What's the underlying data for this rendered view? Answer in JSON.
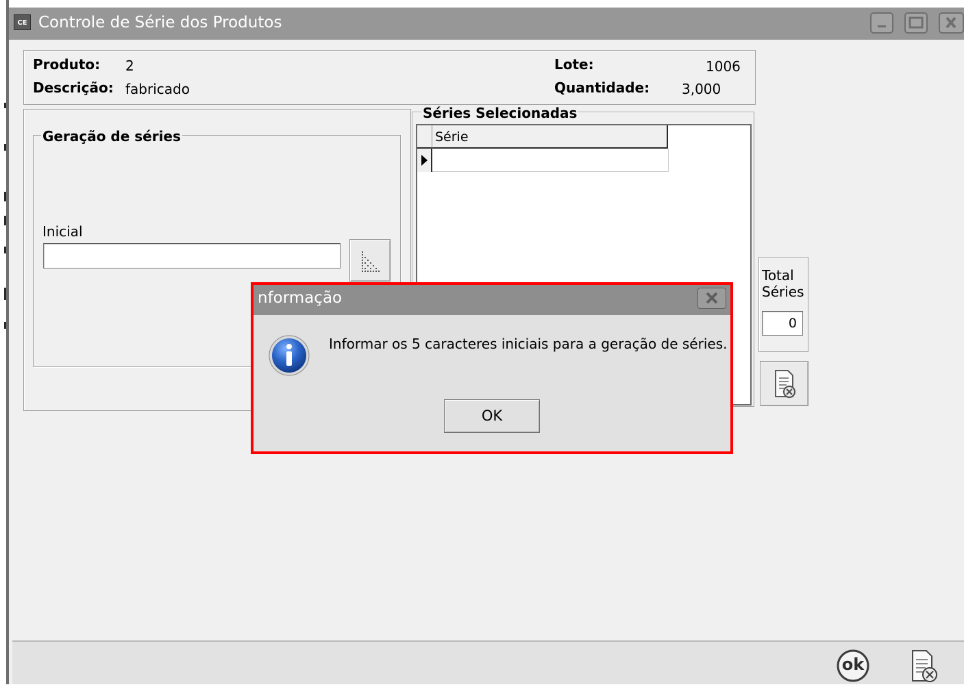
{
  "window": {
    "title": "Controle de Série dos Produtos",
    "icon_text": "CE"
  },
  "header": {
    "produto_label": "Produto:",
    "produto_value": "2",
    "descricao_label": "Descrição:",
    "descricao_value": "fabricado",
    "lote_label": "Lote:",
    "lote_value": "1006",
    "quantidade_label": "Quantidade:",
    "quantidade_value": "3,000"
  },
  "geracao": {
    "title": "Geração de séries",
    "inicial_label": "Inicial",
    "inicial_value": ""
  },
  "series": {
    "title": "Séries Selecionadas",
    "column_header": "Série"
  },
  "total": {
    "label_line1": "Total",
    "label_line2": "Séries",
    "value": "0"
  },
  "dialog": {
    "title": "nformação",
    "message": "Informar os 5 caracteres iniciais para a geração de séries.",
    "ok_label": "OK"
  },
  "footer": {
    "ok_icon_text": "ok"
  },
  "colors": {
    "titlebar": "#979797",
    "highlight": "#ff0000",
    "info_icon": "#2a64c8"
  }
}
